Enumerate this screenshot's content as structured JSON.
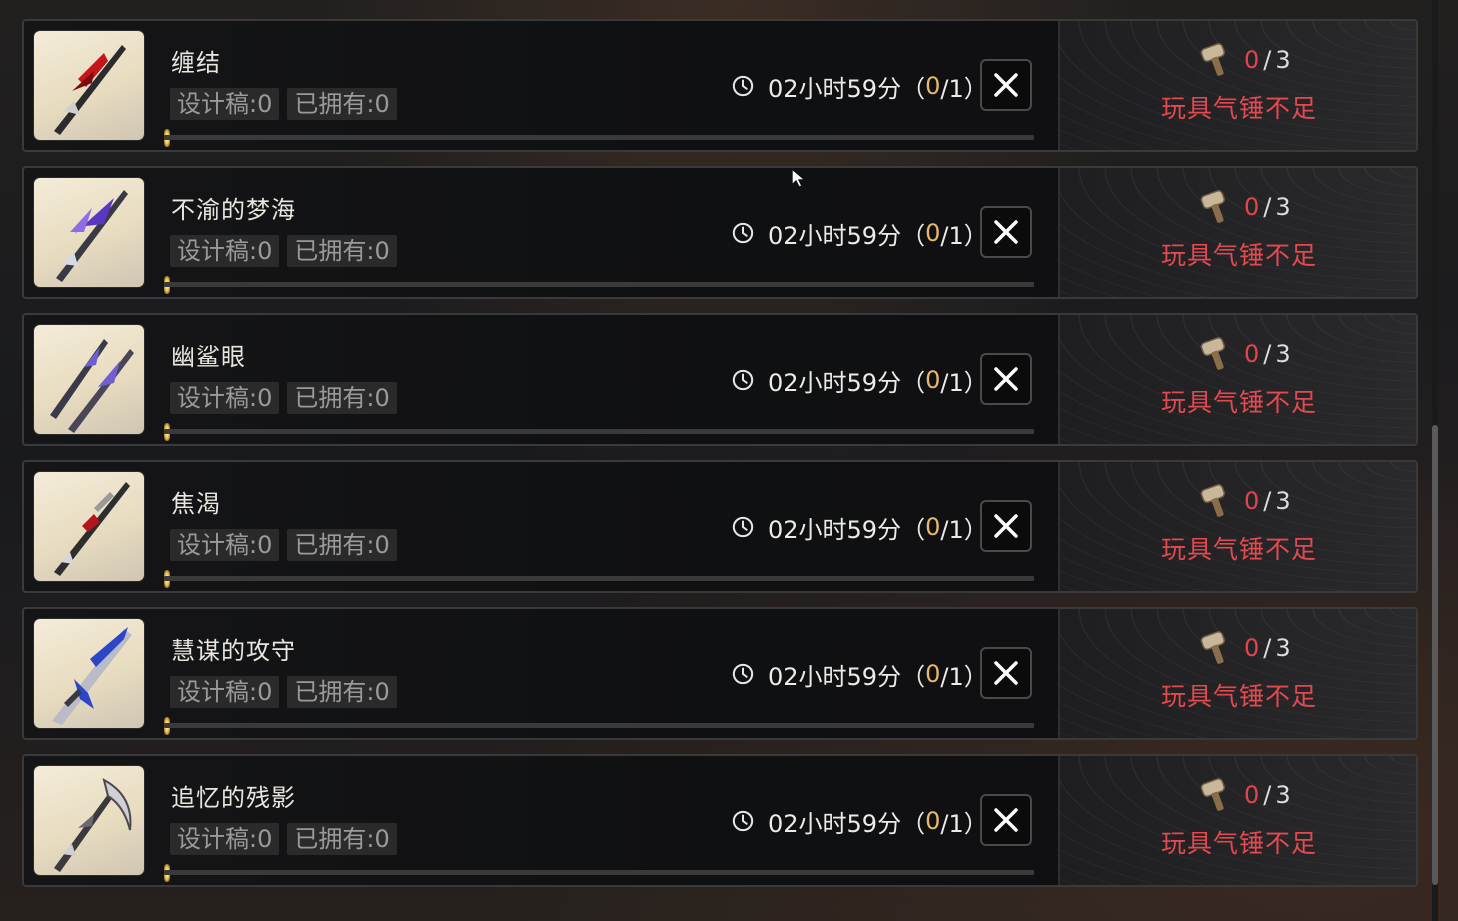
{
  "colors": {
    "progress_fill": "#d9b064",
    "warn_red": "#e24a4f",
    "timer_highlight": "#e8b86a"
  },
  "items": [
    {
      "name": "缠结",
      "design_label": "设计稿:0",
      "owned_label": "已拥有:0",
      "time": "02小时59分",
      "count_open": "（",
      "count_done": "0",
      "count_total": "/1）",
      "hammer_have": "0",
      "hammer_sep": "/",
      "hammer_need": "3",
      "warning": "玩具气锤不足",
      "progress": 0,
      "weapon_icon": "red-black-sword-icon"
    },
    {
      "name": "不渝的梦海",
      "design_label": "设计稿:0",
      "owned_label": "已拥有:0",
      "time": "02小时59分",
      "count_open": "（",
      "count_done": "0",
      "count_total": "/1）",
      "hammer_have": "0",
      "hammer_sep": "/",
      "hammer_need": "3",
      "warning": "玩具气锤不足",
      "progress": 0,
      "weapon_icon": "purple-winged-sword-icon"
    },
    {
      "name": "幽鲨眼",
      "design_label": "设计稿:0",
      "owned_label": "已拥有:0",
      "time": "02小时59分",
      "count_open": "（",
      "count_done": "0",
      "count_total": "/1）",
      "hammer_have": "0",
      "hammer_sep": "/",
      "hammer_need": "3",
      "warning": "玩具气锤不足",
      "progress": 0,
      "weapon_icon": "twin-blades-icon"
    },
    {
      "name": "焦渴",
      "design_label": "设计稿:0",
      "owned_label": "已拥有:0",
      "time": "02小时59分",
      "count_open": "（",
      "count_done": "0",
      "count_total": "/1）",
      "hammer_have": "0",
      "hammer_sep": "/",
      "hammer_need": "3",
      "warning": "玩具气锤不足",
      "progress": 0,
      "weapon_icon": "serrated-sword-icon"
    },
    {
      "name": "慧谋的攻守",
      "design_label": "设计稿:0",
      "owned_label": "已拥有:0",
      "time": "02小时59分",
      "count_open": "（",
      "count_done": "0",
      "count_total": "/1）",
      "hammer_have": "0",
      "hammer_sep": "/",
      "hammer_need": "3",
      "warning": "玩具气锤不足",
      "progress": 0,
      "weapon_icon": "blue-greatsword-icon"
    },
    {
      "name": "追忆的残影",
      "design_label": "设计稿:0",
      "owned_label": "已拥有:0",
      "time": "02小时59分",
      "count_open": "（",
      "count_done": "0",
      "count_total": "/1）",
      "hammer_have": "0",
      "hammer_sep": "/",
      "hammer_need": "3",
      "warning": "玩具气锤不足",
      "progress": 0,
      "weapon_icon": "crescent-scythe-icon"
    }
  ]
}
